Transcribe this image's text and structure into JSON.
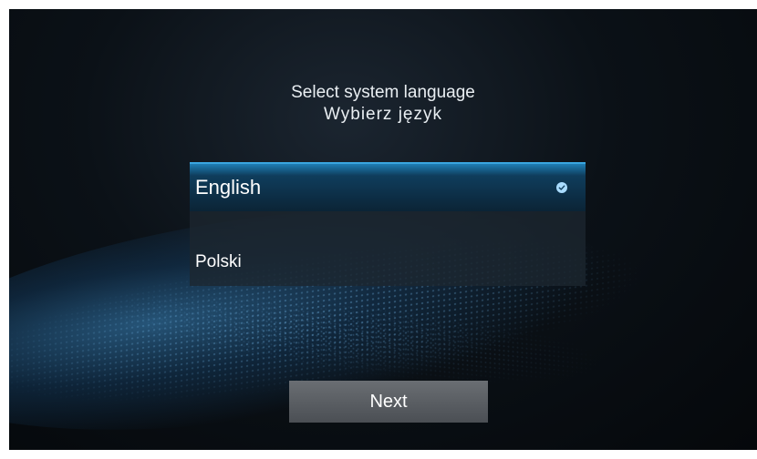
{
  "header": {
    "title_en": "Select system language",
    "title_pl": "Wybierz język"
  },
  "languages": [
    {
      "label": "English",
      "selected": true,
      "icon": "check-circle-icon"
    },
    {
      "label": "Polski",
      "selected": false
    }
  ],
  "footer": {
    "next_label": "Next"
  },
  "colors": {
    "accent": "#1f7fb5",
    "check": "#a9dcff"
  }
}
